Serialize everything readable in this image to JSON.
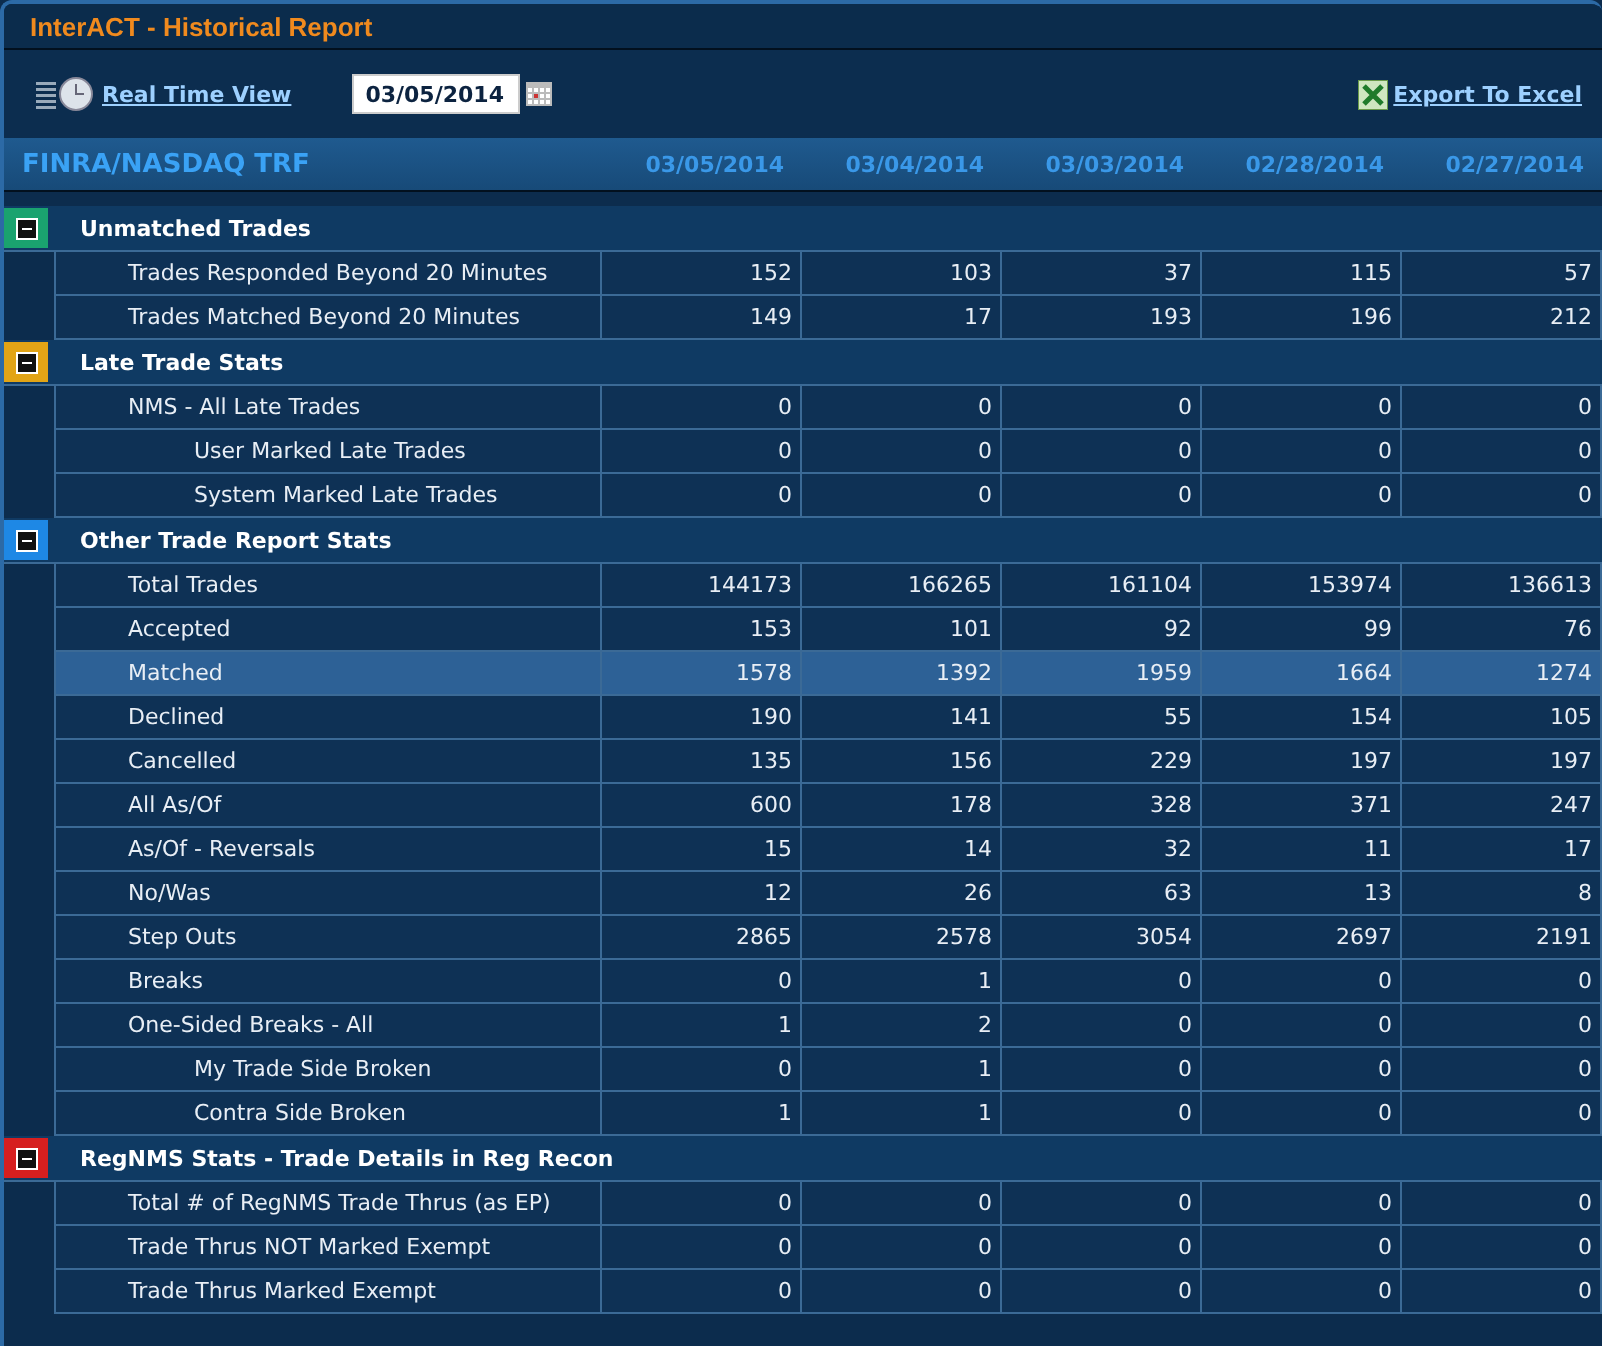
{
  "window": {
    "title": "InterACT - Historical Report"
  },
  "toolbar": {
    "realtime_link": "Real Time View",
    "date_field": {
      "value": "03/05/2014"
    },
    "export_link": "Export To Excel"
  },
  "table": {
    "title": "FINRA/NASDAQ TRF",
    "columns": [
      "03/05/2014",
      "03/04/2014",
      "03/03/2014",
      "02/28/2014",
      "02/27/2014"
    ],
    "sections": [
      {
        "title": "Unmatched Trades",
        "color": "#1aa36f",
        "expanded": true,
        "rows": [
          {
            "label": "Trades Responded Beyond 20 Minutes",
            "values": [
              "152",
              "103",
              "37",
              "115",
              "57"
            ],
            "selected": false
          },
          {
            "label": "Trades Matched Beyond 20 Minutes",
            "values": [
              "149",
              "17",
              "193",
              "196",
              "212"
            ],
            "selected": false
          }
        ]
      },
      {
        "title": "Late Trade Stats",
        "color": "#e2a416",
        "expanded": true,
        "rows": [
          {
            "label": "NMS - All Late Trades",
            "values": [
              "0",
              "0",
              "0",
              "0",
              "0"
            ],
            "selected": false,
            "children": [
              {
                "label": "User Marked Late Trades",
                "values": [
                  "0",
                  "0",
                  "0",
                  "0",
                  "0"
                ],
                "selected": false
              },
              {
                "label": "System Marked Late Trades",
                "values": [
                  "0",
                  "0",
                  "0",
                  "0",
                  "0"
                ],
                "selected": false
              }
            ]
          }
        ]
      },
      {
        "title": "Other Trade Report Stats",
        "color": "#1e88e5",
        "expanded": true,
        "rows": [
          {
            "label": "Total Trades",
            "values": [
              "144173",
              "166265",
              "161104",
              "153974",
              "136613"
            ],
            "selected": false
          },
          {
            "label": "Accepted",
            "values": [
              "153",
              "101",
              "92",
              "99",
              "76"
            ],
            "selected": false
          },
          {
            "label": "Matched",
            "values": [
              "1578",
              "1392",
              "1959",
              "1664",
              "1274"
            ],
            "selected": true
          },
          {
            "label": "Declined",
            "values": [
              "190",
              "141",
              "55",
              "154",
              "105"
            ],
            "selected": false
          },
          {
            "label": "Cancelled",
            "values": [
              "135",
              "156",
              "229",
              "197",
              "197"
            ],
            "selected": false
          },
          {
            "label": "All As/Of",
            "values": [
              "600",
              "178",
              "328",
              "371",
              "247"
            ],
            "selected": false
          },
          {
            "label": "As/Of - Reversals",
            "values": [
              "15",
              "14",
              "32",
              "11",
              "17"
            ],
            "selected": false
          },
          {
            "label": "No/Was",
            "values": [
              "12",
              "26",
              "63",
              "13",
              "8"
            ],
            "selected": false
          },
          {
            "label": "Step Outs",
            "values": [
              "2865",
              "2578",
              "3054",
              "2697",
              "2191"
            ],
            "selected": false
          },
          {
            "label": "Breaks",
            "values": [
              "0",
              "1",
              "0",
              "0",
              "0"
            ],
            "selected": false
          },
          {
            "label": "One-Sided Breaks - All",
            "values": [
              "1",
              "2",
              "0",
              "0",
              "0"
            ],
            "selected": false,
            "children": [
              {
                "label": "My Trade Side Broken",
                "values": [
                  "0",
                  "1",
                  "0",
                  "0",
                  "0"
                ],
                "selected": false
              },
              {
                "label": "Contra Side Broken",
                "values": [
                  "1",
                  "1",
                  "0",
                  "0",
                  "0"
                ],
                "selected": false
              }
            ]
          }
        ]
      },
      {
        "title": "RegNMS Stats - Trade Details in Reg Recon",
        "color": "#d61f1f",
        "expanded": true,
        "rows": [
          {
            "label": "Total # of RegNMS Trade Thrus (as EP)",
            "values": [
              "0",
              "0",
              "0",
              "0",
              "0"
            ],
            "selected": false
          },
          {
            "label": "Trade Thrus NOT Marked Exempt",
            "values": [
              "0",
              "0",
              "0",
              "0",
              "0"
            ],
            "selected": false
          },
          {
            "label": "Trade Thrus Marked Exempt",
            "values": [
              "0",
              "0",
              "0",
              "0",
              "0"
            ],
            "selected": false
          }
        ]
      }
    ]
  }
}
